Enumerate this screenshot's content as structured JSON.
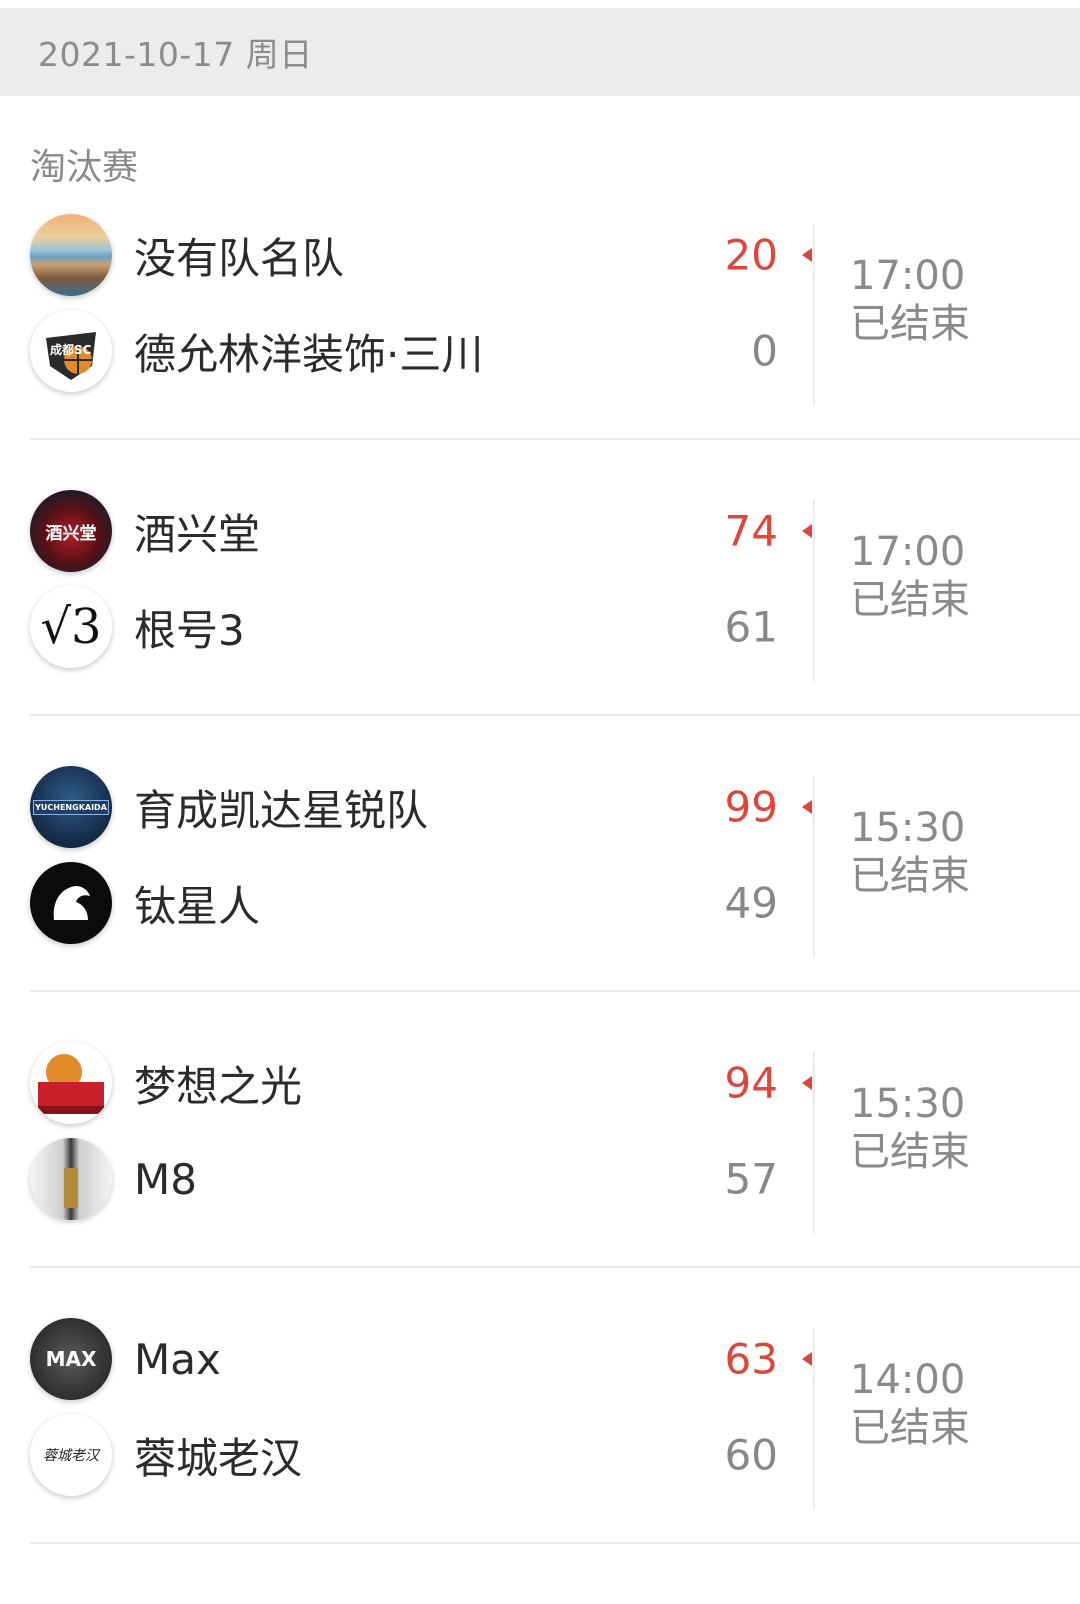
{
  "header": {
    "date": "2021-10-17 周日"
  },
  "section": {
    "title": "淘汰赛"
  },
  "colors": {
    "win_score": "#e0453a",
    "lose_score": "#888888",
    "date_bar_bg": "#ececec"
  },
  "matches": [
    {
      "home": {
        "name": "没有队名队",
        "score": "20",
        "logo": "landscape-logo"
      },
      "away": {
        "name": "德允林洋装饰·三川",
        "score": "0",
        "logo": "sc-basketball-logo"
      },
      "time": "17:00",
      "status": "已结束",
      "winner": "home"
    },
    {
      "home": {
        "name": "酒兴堂",
        "score": "74",
        "logo": "jiuxingtang-logo"
      },
      "away": {
        "name": "根号3",
        "score": "61",
        "logo": "sqrt3-logo"
      },
      "time": "17:00",
      "status": "已结束",
      "winner": "home"
    },
    {
      "home": {
        "name": "育成凯达星锐队",
        "score": "99",
        "logo": "yuchengkaida-logo"
      },
      "away": {
        "name": "钛星人",
        "score": "49",
        "logo": "titan-logo"
      },
      "time": "15:30",
      "status": "已结束",
      "winner": "home"
    },
    {
      "home": {
        "name": "梦想之光",
        "score": "94",
        "logo": "dream-light-logo"
      },
      "away": {
        "name": "M8",
        "score": "57",
        "logo": "m8-logo"
      },
      "time": "15:30",
      "status": "已结束",
      "winner": "home"
    },
    {
      "home": {
        "name": "Max",
        "score": "63",
        "logo": "max-logo"
      },
      "away": {
        "name": "蓉城老汉",
        "score": "60",
        "logo": "rongcheng-logo"
      },
      "time": "14:00",
      "status": "已结束",
      "winner": "home"
    }
  ],
  "logo_text": {
    "jiuxingtang": "酒兴堂",
    "sqrt3": "√3",
    "yuchengkaida": "YUCHENGKAIDA",
    "max": "MAX",
    "rongcheng": "蓉城老汉"
  }
}
